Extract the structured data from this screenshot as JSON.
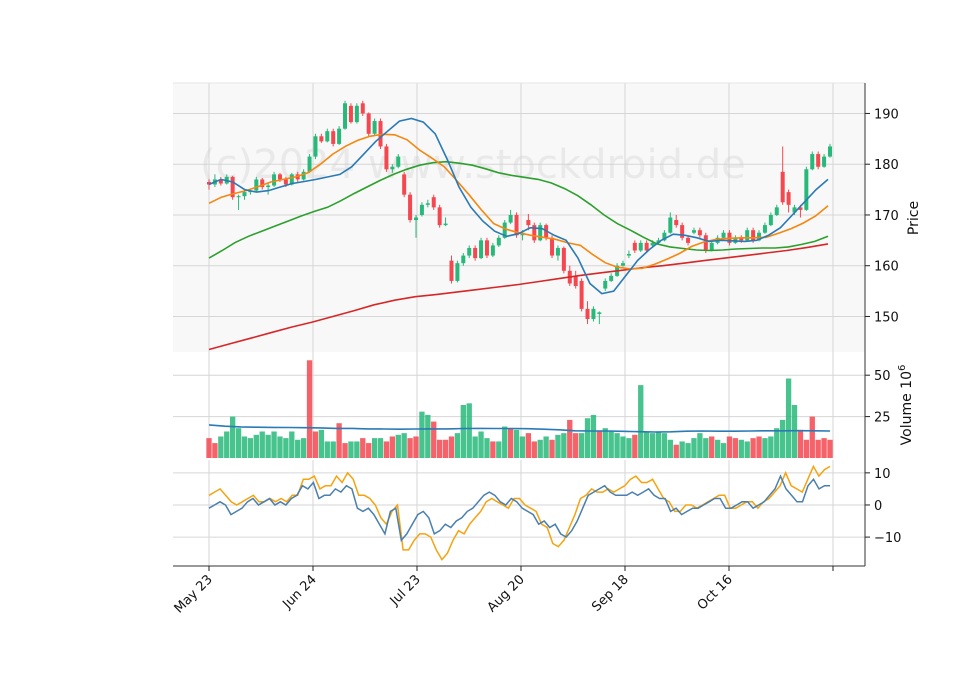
{
  "chart_data": {
    "type": "candlestick",
    "watermark": "(c)2024 www.stockdroid.de",
    "x_tick_labels": [
      "May 23",
      "Jun 24",
      "Jul 23",
      "Aug 20",
      "Sep 18",
      "Oct 16",
      ""
    ],
    "price_panel": {
      "ylabel": "Price",
      "ylim": [
        143,
        196
      ],
      "yticks": [
        150,
        160,
        170,
        180,
        190
      ],
      "candles": [
        [
          176.5,
          177,
          175,
          176,
          "down"
        ],
        [
          176,
          178,
          175.5,
          177,
          "up"
        ],
        [
          177,
          177.5,
          175.8,
          176.2,
          "down"
        ],
        [
          176.2,
          178,
          176,
          177.5,
          "up"
        ],
        [
          177.5,
          177.7,
          173,
          173.5,
          "down"
        ],
        [
          173.5,
          174,
          171,
          173.7,
          "up"
        ],
        [
          173.7,
          175,
          173,
          174.5,
          "up"
        ],
        [
          174.5,
          175.2,
          174,
          174.8,
          "up"
        ],
        [
          174.8,
          177.5,
          174.5,
          177,
          "up"
        ],
        [
          177,
          177.3,
          175,
          175.5,
          "down"
        ],
        [
          175.5,
          176.2,
          174,
          175.8,
          "up"
        ],
        [
          175.8,
          178.5,
          175.5,
          178,
          "up"
        ],
        [
          178,
          178.3,
          176.5,
          177,
          "down"
        ],
        [
          177,
          177.5,
          175.5,
          176,
          "down"
        ],
        [
          176,
          178.3,
          175.8,
          178,
          "up"
        ],
        [
          178,
          178.5,
          176.5,
          177,
          "down"
        ],
        [
          177,
          179,
          176.8,
          178.5,
          "up"
        ],
        [
          178.5,
          182,
          178.3,
          181.5,
          "up"
        ],
        [
          181.5,
          186,
          181,
          185.5,
          "up"
        ],
        [
          185.5,
          186,
          184.2,
          184.5,
          "down"
        ],
        [
          184.5,
          187,
          184.3,
          186.5,
          "up"
        ],
        [
          186.5,
          187,
          183.5,
          184,
          "down"
        ],
        [
          184,
          187.5,
          183.8,
          187,
          "up"
        ],
        [
          187,
          192.5,
          186.8,
          192,
          "up"
        ],
        [
          191.5,
          192,
          188,
          188.3,
          "down"
        ],
        [
          188.3,
          192,
          188,
          191.5,
          "up"
        ],
        [
          192,
          192.5,
          189.5,
          190,
          "down"
        ],
        [
          190,
          190.2,
          185.5,
          186,
          "down"
        ],
        [
          186,
          189,
          185.7,
          188.5,
          "up"
        ],
        [
          188.5,
          189,
          183,
          183.5,
          "down"
        ],
        [
          183.5,
          184,
          178.5,
          179,
          "down"
        ],
        [
          179,
          180,
          178.3,
          179.5,
          "up"
        ],
        [
          179.5,
          182,
          179.2,
          181.5,
          "up"
        ],
        [
          178,
          178.5,
          173.5,
          174,
          "down"
        ],
        [
          174,
          174.5,
          168.5,
          169,
          "down"
        ],
        [
          169,
          170,
          165.5,
          169.5,
          "up"
        ],
        [
          170,
          172.5,
          169.7,
          172,
          "up"
        ],
        [
          172,
          173,
          171.5,
          172.3,
          "up"
        ],
        [
          173.5,
          174,
          171,
          171.5,
          "down"
        ],
        [
          171.5,
          172,
          167.5,
          168,
          "down"
        ],
        [
          168,
          169.5,
          167.8,
          168.3,
          "up"
        ],
        [
          161,
          162,
          156.5,
          157,
          "down"
        ],
        [
          157,
          161,
          156.7,
          160.5,
          "up"
        ],
        [
          160.5,
          162.5,
          160,
          162,
          "up"
        ],
        [
          162,
          164,
          161.5,
          163.5,
          "up"
        ],
        [
          163.5,
          164,
          161,
          161.5,
          "down"
        ],
        [
          161.5,
          165.5,
          161.3,
          165,
          "up"
        ],
        [
          165,
          165.5,
          161.5,
          162,
          "down"
        ],
        [
          162,
          164.5,
          161.7,
          164,
          "up"
        ],
        [
          164,
          166,
          163.7,
          165.5,
          "up"
        ],
        [
          165.5,
          169,
          165.3,
          168.5,
          "up"
        ],
        [
          168.5,
          171,
          168.2,
          170,
          "up"
        ],
        [
          170,
          170.5,
          165.5,
          166,
          "down"
        ],
        [
          166,
          167,
          165,
          166.5,
          "up"
        ],
        [
          169,
          170.2,
          167,
          168,
          "down"
        ],
        [
          168,
          168.5,
          164.5,
          165,
          "down"
        ],
        [
          165,
          168.5,
          164.8,
          168,
          "up"
        ],
        [
          168,
          168.3,
          165,
          165.5,
          "down"
        ],
        [
          165.5,
          166,
          161.5,
          162,
          "down"
        ],
        [
          162,
          164,
          161,
          163.5,
          "up"
        ],
        [
          163.5,
          163.8,
          158.5,
          159,
          "down"
        ],
        [
          159,
          160,
          156,
          156.5,
          "down"
        ],
        [
          158,
          159,
          155.5,
          156,
          "down"
        ],
        [
          157,
          157.5,
          151,
          151.5,
          "down"
        ],
        [
          151.5,
          153,
          148.5,
          149.5,
          "down"
        ],
        [
          149.5,
          152,
          149,
          151.5,
          "up"
        ],
        [
          150.5,
          151,
          148.5,
          150.8,
          "up"
        ],
        [
          155.5,
          157.5,
          155,
          157,
          "up"
        ],
        [
          157,
          158.5,
          156.8,
          158,
          "up"
        ],
        [
          158,
          160.5,
          157.8,
          160,
          "up"
        ],
        [
          160,
          161,
          159.8,
          160.5,
          "up"
        ],
        [
          162,
          163,
          161.5,
          162.3,
          "up"
        ],
        [
          164.5,
          165,
          162.5,
          163,
          "down"
        ],
        [
          163,
          165,
          162.7,
          164.5,
          "up"
        ],
        [
          164.5,
          165,
          162.5,
          163,
          "down"
        ],
        [
          164,
          165,
          163.8,
          164.5,
          "up"
        ],
        [
          164.5,
          165.5,
          164.2,
          165,
          "up"
        ],
        [
          165,
          167,
          164.8,
          166.5,
          "up"
        ],
        [
          166.5,
          170.5,
          166.3,
          169.5,
          "up"
        ],
        [
          169,
          170,
          167.5,
          168,
          "down"
        ],
        [
          168,
          168.5,
          165,
          165.5,
          "down"
        ],
        [
          165.5,
          166,
          164,
          164.5,
          "down"
        ],
        [
          166.5,
          167.5,
          166.2,
          167,
          "up"
        ],
        [
          167,
          167.5,
          165.5,
          166,
          "down"
        ],
        [
          166,
          166.5,
          162.5,
          163,
          "down"
        ],
        [
          163,
          165,
          162.8,
          164.5,
          "up"
        ],
        [
          164.5,
          166,
          164.2,
          165.5,
          "up"
        ],
        [
          165.5,
          167,
          165.3,
          166.5,
          "up"
        ],
        [
          166.5,
          167,
          164,
          164.5,
          "down"
        ],
        [
          164.5,
          166,
          164.3,
          165.5,
          "up"
        ],
        [
          165.5,
          166,
          164.5,
          165,
          "down"
        ],
        [
          165,
          167.5,
          164.8,
          167,
          "up"
        ],
        [
          167,
          167.5,
          164.5,
          165,
          "down"
        ],
        [
          165,
          167,
          164.8,
          166.5,
          "up"
        ],
        [
          166.5,
          168.5,
          166.3,
          168,
          "up"
        ],
        [
          168,
          170.5,
          167.8,
          170,
          "up"
        ],
        [
          170,
          172,
          169.8,
          171.5,
          "up"
        ],
        [
          178.5,
          183.5,
          172,
          172.5,
          "down"
        ],
        [
          174.5,
          175,
          170.5,
          172,
          "down"
        ],
        [
          170.5,
          172,
          170,
          171.5,
          "up"
        ],
        [
          171.5,
          172,
          169.5,
          171,
          "down"
        ],
        [
          171,
          179.5,
          170.8,
          179,
          "up"
        ],
        [
          179,
          182.5,
          178.8,
          182,
          "up"
        ],
        [
          182,
          182.5,
          179,
          179.5,
          "down"
        ],
        [
          179.5,
          182,
          179.3,
          181.5,
          "up"
        ],
        [
          181.5,
          184,
          181.3,
          183.5,
          "up"
        ]
      ],
      "ma_blue": [
        176,
        177,
        176.5,
        175,
        174.5,
        174.8,
        175.5,
        176.2,
        176.6,
        177,
        177.5,
        178,
        179.5,
        182,
        184.5,
        186.5,
        188.5,
        189,
        188.3,
        186,
        181,
        175.5,
        171.5,
        168.8,
        166.8,
        165.8,
        166.3,
        167.5,
        167.3,
        166,
        165,
        161.5,
        156.5,
        154.5,
        155,
        158,
        161,
        163.2,
        165,
        166.2,
        166,
        165.5,
        164.8,
        165,
        164.9,
        164.8,
        165,
        166,
        167.5,
        170,
        172.5,
        175,
        177
      ],
      "ma_orange": [
        172.3,
        173.5,
        174.2,
        174.8,
        175.6,
        176.5,
        177,
        177.5,
        178.3,
        180,
        182,
        183.5,
        184.7,
        185.5,
        185.9,
        185.8,
        184.8,
        182.8,
        181.2,
        179.5,
        176.8,
        174,
        171,
        168.3,
        167.2,
        166.5,
        166,
        165.6,
        165.2,
        164.5,
        164,
        162.2,
        160.6,
        159.7,
        159.4,
        159.5,
        160.3,
        161.3,
        162.4,
        163.8,
        164.7,
        165.2,
        165.4,
        165.5,
        165.5,
        165.6,
        166.4,
        167.3,
        168.4,
        169.8,
        171.8
      ],
      "ma_green": [
        161.5,
        163,
        164.6,
        165.8,
        166.8,
        167.8,
        168.8,
        169.8,
        170.7,
        171.5,
        172.8,
        174.2,
        175.5,
        176.8,
        178,
        179,
        179.8,
        180.3,
        180.5,
        180.2,
        179.8,
        179.1,
        178.3,
        177.8,
        177.4,
        177,
        176.3,
        175.2,
        173.8,
        172,
        170,
        168.3,
        167,
        165.6,
        164.3,
        163.7,
        163.4,
        163.1,
        163,
        163.1,
        163.3,
        163.4,
        163.5,
        163.5,
        163.7,
        164.2,
        164.8,
        165.8
      ],
      "ma_red": [
        143.5,
        144.6,
        145.7,
        146.8,
        147.9,
        148.9,
        150,
        151.1,
        152.3,
        153.2,
        153.9,
        154.3,
        154.8,
        155.3,
        155.8,
        156.3,
        156.9,
        157.5,
        158.1,
        158.6,
        159.1,
        159.6,
        160,
        160.5,
        161,
        161.5,
        162,
        162.5,
        163,
        163.6,
        164.3
      ]
    },
    "volume_panel": {
      "ylabel": "Volume $10^6$",
      "ylim": [
        0,
        64
      ],
      "yticks": [
        25,
        50
      ],
      "bars": [
        12,
        9,
        13,
        16,
        25,
        18,
        13,
        12,
        14,
        16,
        14,
        16,
        13,
        12,
        16,
        11,
        12,
        59,
        16,
        17,
        10,
        10,
        21,
        9,
        10,
        10,
        12,
        9,
        12,
        12,
        10,
        13,
        14,
        15,
        12,
        13,
        28,
        26,
        22,
        11,
        11,
        13,
        15,
        32,
        33,
        13,
        16,
        12,
        10,
        10,
        19,
        18,
        17,
        13,
        15,
        10,
        11,
        13,
        11,
        14,
        15,
        23,
        15,
        15,
        24,
        26,
        16,
        18,
        16,
        15,
        13,
        12,
        14,
        44,
        16,
        15,
        16,
        15,
        11,
        8,
        10,
        9,
        12,
        15,
        12,
        13,
        11,
        9,
        13,
        12,
        11,
        10,
        12,
        13,
        12,
        13,
        18,
        23,
        48,
        32,
        17,
        11,
        25,
        11,
        12,
        11
      ],
      "bar_dirs": "dduuuuuuuuuuuuuuudduuudduudduudduudduudddduuuuuuduuduudduuduudduuuduuuuuduuuuuuduuuuuduudduudduuuuuud",
      "avg": [
        20,
        19.2,
        18.8,
        18.6,
        18.5,
        18.4,
        18.3,
        18.2,
        17.9,
        17.9,
        17.6,
        17.5,
        17.4,
        17.5,
        17.6,
        17.6,
        17.8,
        17.9,
        17.8,
        17.8,
        17.7,
        17.4,
        17,
        16.4,
        16.3,
        16.3,
        16.1,
        15.9,
        15.7,
        15.8,
        16.2,
        16.3,
        16.2,
        16.2,
        16.3,
        16.4,
        16.4,
        16.5,
        16.4,
        16.3
      ]
    },
    "indicator_panel": {
      "ylim": [
        -19,
        14
      ],
      "yticks": [
        -10,
        0,
        10
      ],
      "line_blue": [
        -1,
        0,
        1,
        0,
        -3,
        -2,
        -1,
        1,
        2,
        0,
        1,
        2,
        0,
        1,
        0,
        2,
        3,
        6,
        5,
        7,
        2,
        3,
        3,
        5,
        4,
        6,
        5,
        -1,
        -2,
        -1,
        -3,
        -6,
        -9,
        -2,
        -1,
        -11,
        -9,
        -6,
        -3,
        -2,
        -4,
        -9,
        -8,
        -6,
        -7,
        -5,
        -4,
        -2,
        -1,
        1,
        3,
        4,
        3,
        1,
        0,
        2,
        1,
        -1,
        -2,
        -3,
        -6,
        -5,
        -7,
        -6,
        -9,
        -10,
        -8,
        -5,
        -1,
        3,
        4,
        5,
        6,
        4,
        3,
        3,
        3,
        4,
        3,
        4,
        5,
        3,
        2,
        2,
        -2,
        -1,
        -3,
        -2,
        -1,
        -1,
        0,
        1,
        2,
        2,
        -1,
        -1,
        0,
        1,
        1,
        -1,
        0,
        1,
        3,
        5,
        9,
        5,
        3,
        1,
        1,
        6,
        8,
        5,
        6,
        6
      ],
      "line_orange": [
        3,
        4,
        5,
        3,
        1,
        0,
        1,
        2,
        3,
        1,
        1,
        2,
        1,
        2,
        1,
        3,
        3,
        8,
        8,
        9,
        5,
        6,
        6,
        9,
        7,
        10,
        8,
        3,
        3,
        2,
        0,
        -4,
        -6,
        -2,
        0,
        -14,
        -14,
        -11,
        -9,
        -9,
        -10,
        -14,
        -17,
        -15,
        -11,
        -8,
        -9,
        -6,
        -4,
        -2,
        1,
        2,
        1,
        0,
        -1,
        2,
        2,
        0,
        -1,
        -2,
        -6,
        -7,
        -12,
        -13,
        -11,
        -7,
        -3,
        2,
        3,
        5,
        4,
        4,
        5,
        4,
        5,
        6,
        8,
        9,
        7,
        7,
        8,
        5,
        2,
        1,
        -2,
        -2,
        0,
        0,
        -1,
        0,
        1,
        2,
        3,
        3,
        -1,
        -1,
        0,
        1,
        1,
        -1,
        1,
        2,
        4,
        6,
        10,
        6,
        5,
        4,
        8,
        12,
        9,
        11,
        12
      ]
    }
  }
}
